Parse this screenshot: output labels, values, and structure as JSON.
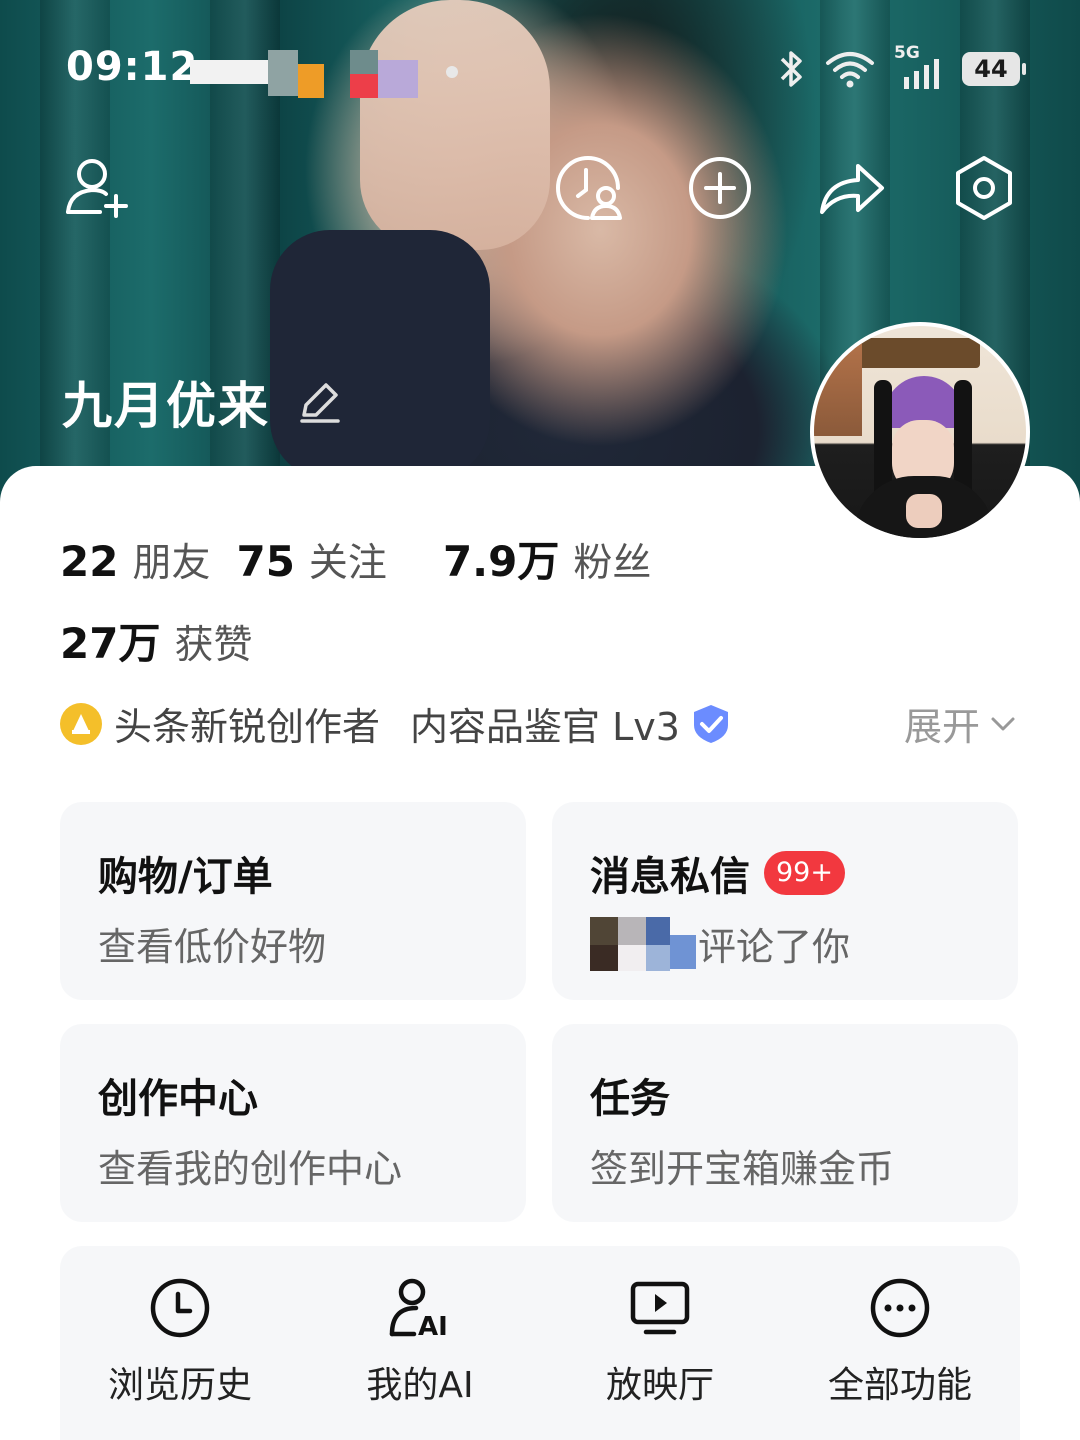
{
  "status_bar": {
    "time": "09:12",
    "battery": "44",
    "network": "5G"
  },
  "profile": {
    "name": "九月优来"
  },
  "stats": [
    {
      "num": "22",
      "label": "朋友"
    },
    {
      "num": "75",
      "label": "关注"
    },
    {
      "num": "7.9万",
      "label": "粉丝"
    }
  ],
  "likes": {
    "num": "27万",
    "label": "获赞"
  },
  "badges": {
    "creator": "头条新锐创作者",
    "curator": "内容品鉴官 Lv3",
    "expand": "展开"
  },
  "cards": [
    {
      "title": "购物/订单",
      "sub": "查看低价好物"
    },
    {
      "title": "消息私信",
      "badge": "99+",
      "sub": "评论了你"
    },
    {
      "title": "创作中心",
      "sub": "查看我的创作中心"
    },
    {
      "title": "任务",
      "sub": "签到开宝箱赚金币"
    }
  ],
  "tools": [
    {
      "label": "浏览历史",
      "icon": "clock-icon"
    },
    {
      "label": "我的AI",
      "icon": "ai-user-icon"
    },
    {
      "label": "放映厅",
      "icon": "play-screen-icon"
    },
    {
      "label": "全部功能",
      "icon": "more-icon"
    }
  ],
  "colors": {
    "accent_red": "#f2383f",
    "coin_yellow": "#f4bf2a",
    "verify_blue": "#6b8cff"
  }
}
